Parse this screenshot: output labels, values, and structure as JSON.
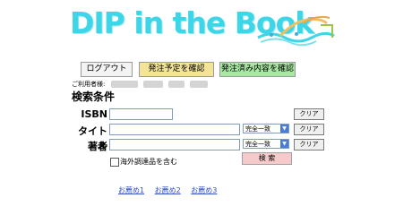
{
  "header": {
    "logo_text": "DIP in the Book"
  },
  "toolbar": {
    "logout": "ログアウト",
    "check_pending": "発注予定を確認",
    "check_ordered": "発注済み内容を確認"
  },
  "user": {
    "label": "ご利用者様:"
  },
  "search": {
    "heading": "検索条件",
    "isbn_label": "ISBN",
    "isbn_value": "",
    "title_label": "タイトル",
    "title_value": "",
    "title_match": "完全一致",
    "author_label": "著者",
    "author_value": "",
    "author_match": "完全一致",
    "clear_label": "クリア",
    "include_foreign_label": "海外調達品を含む",
    "include_foreign_checked": false,
    "search_button": "検 索"
  },
  "footer": {
    "links": [
      "お薦め1",
      "お薦め2",
      "お薦め3"
    ]
  },
  "colors": {
    "logo": "#3cd6e8",
    "confirm_button": "#f4e49a",
    "ordered_button": "#a9e8a3",
    "search_button": "#f6caca",
    "link": "#2f4fc2"
  }
}
